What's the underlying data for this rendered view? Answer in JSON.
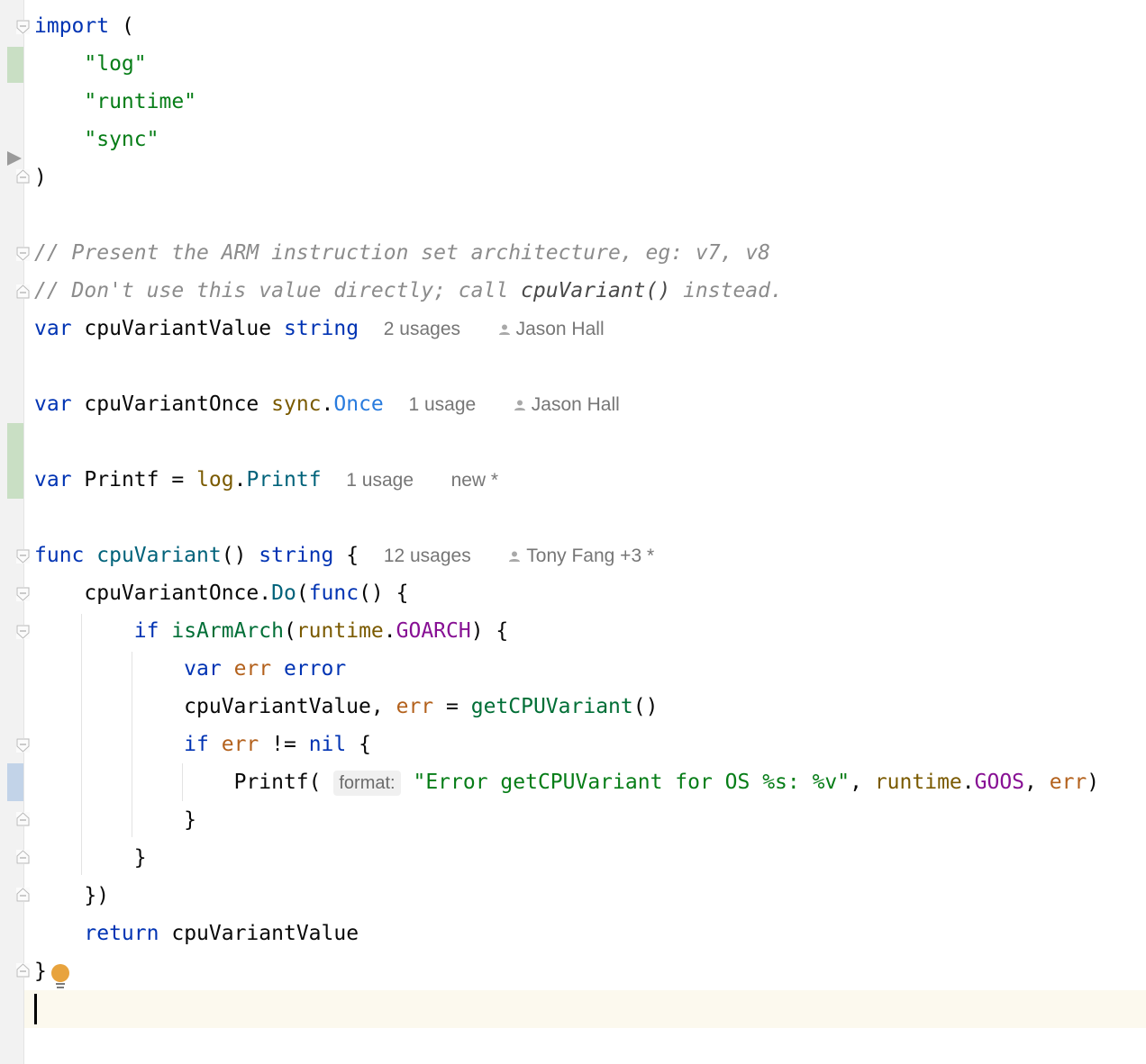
{
  "colors": {
    "keyword": "#0033b3",
    "string": "#067d17",
    "comment": "#8c8c8c",
    "function": "#00627a",
    "package": "#7a5a00",
    "member": "#871094",
    "local_variable": "#b3611c",
    "annotation": "#767676",
    "vcs_added": "#c9dfc4",
    "vcs_modified": "#c2d3e8",
    "caret_line": "#fcf9ee"
  },
  "icons": [
    "fold-icon",
    "run-arrow-icon",
    "person-icon",
    "lightbulb-icon"
  ],
  "code": {
    "import_kw": "import",
    "open_paren": "(",
    "imports": [
      "\"log\"",
      "\"runtime\"",
      "\"sync\""
    ],
    "close_paren": ")",
    "comment1": "// Present the ARM instruction set architecture, eg: v7, v8",
    "comment2_a": "// Don't use this value directly; call ",
    "comment2_b": "cpuVariant()",
    "comment2_c": " instead.",
    "var_kw": "var",
    "cpuVariantValue": "cpuVariantValue",
    "string_type": "string",
    "cpuVariantOnce": "cpuVariantOnce",
    "sync_pkg": "sync",
    "once_type": "Once",
    "printf_var": "Printf",
    "equals": "=",
    "log_pkg": "log",
    "printf_fn": "Printf",
    "func_kw": "func",
    "cpuVariant_fn": "cpuVariant",
    "parens": "()",
    "open_brace": "{",
    "once_call_recv": "cpuVariantOnce",
    "do_method": "Do",
    "if_kw": "if",
    "isArmArch": "isArmArch",
    "runtime_pkg": "runtime",
    "goarch": "GOARCH",
    "err_var": "err",
    "error_type": "error",
    "assign_target": "cpuVariantValue,",
    "getCPUVariant": "getCPUVariant",
    "neq": "!=",
    "nil_kw": "nil",
    "printf_call": "Printf(",
    "format_hint": "format:",
    "format_string": "\"Error getCPUVariant for OS %s: %v\"",
    "goos": "GOOS",
    "close_brace": "}",
    "close_func": "})",
    "return_kw": "return"
  },
  "annotations": {
    "cpuVariantValue_usages": "2 usages",
    "cpuVariantValue_author": "Jason Hall",
    "cpuVariantOnce_usages": "1 usage",
    "cpuVariantOnce_author": "Jason Hall",
    "printf_usages": "1 usage",
    "printf_status": "new *",
    "cpuVariant_usages": "12 usages",
    "cpuVariant_author": "Tony Fang +3 *"
  }
}
